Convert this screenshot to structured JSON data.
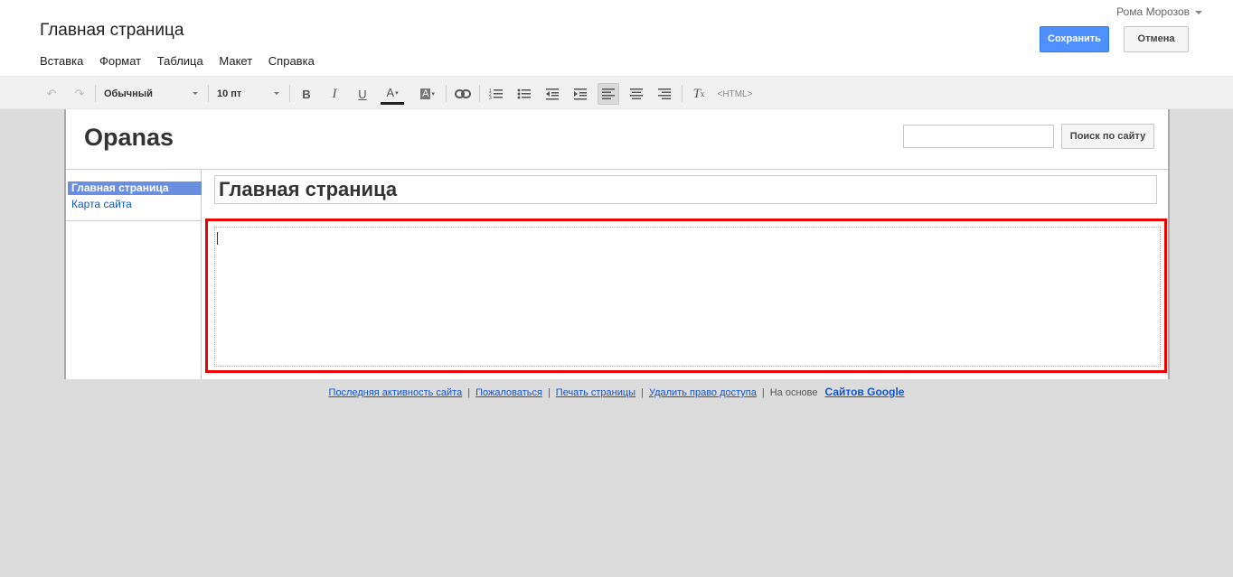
{
  "header": {
    "title": "Главная страница",
    "user": "Рома Морозов",
    "save_label": "Сохранить",
    "cancel_label": "Отмена",
    "menu": [
      "Вставка",
      "Формат",
      "Таблица",
      "Макет",
      "Справка"
    ]
  },
  "toolbar": {
    "style_select": "Обычный",
    "size_select": "10 пт",
    "html_label": "<HTML>"
  },
  "site": {
    "name": "Opanas",
    "search_button": "Поиск по сайту",
    "nav": [
      "Главная страница",
      "Карта сайта"
    ],
    "page_title_field": "Главная страница"
  },
  "footer": {
    "links": [
      "Последняя активность сайта",
      "Пожаловаться",
      "Печать страницы",
      "Удалить право доступа"
    ],
    "powered_by": "На основе",
    "brand": "Сайтов Google"
  },
  "colors": {
    "accent": "#4d90fe",
    "highlight": "#e00000",
    "nav_selected": "#6b8fe0"
  }
}
